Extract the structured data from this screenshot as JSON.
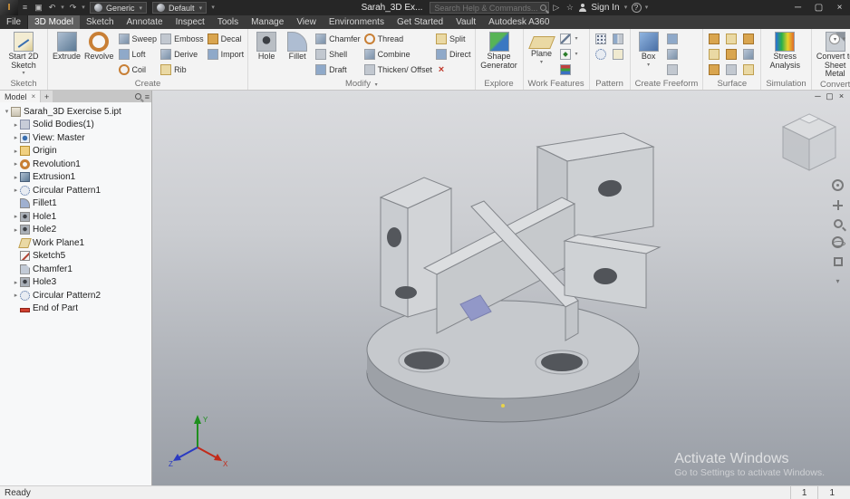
{
  "colors": {
    "titlebar_bg": "#262626",
    "tabrow_bg": "#3b3b3b",
    "ribbon_bg": "#f3f3f3",
    "viewport_gradient_top": "#dbdcdf",
    "viewport_gradient_bottom": "#989da5",
    "model_gray": "#c6c9cd",
    "selection_highlight_purple": "#9298c8"
  },
  "icons": {
    "caret_down": "▾",
    "expander_collapsed": "▸",
    "expander_expanded": "▾",
    "close": "×",
    "minimize": "─",
    "restore": "▢",
    "hamburger": "≡",
    "plus": "+",
    "save": "▣",
    "undo": "↶",
    "redo": "↷",
    "share": "▷",
    "star": "☆",
    "help": "?",
    "delete_x": "×"
  },
  "titlebar": {
    "document_title": "Sarah_3D Ex...",
    "search_placeholder": "Search Help & Commands...",
    "sign_in_label": "Sign In",
    "material_selector": "Generic",
    "appearance_selector": "Default"
  },
  "tabs": [
    "File",
    "3D Model",
    "Sketch",
    "Annotate",
    "Inspect",
    "Tools",
    "Manage",
    "View",
    "Environments",
    "Get Started",
    "Vault",
    "Autodesk A360"
  ],
  "active_tab": "3D Model",
  "ribbon": {
    "sketch": {
      "label": "Sketch",
      "start_2d_sketch": "Start 2D Sketch"
    },
    "create": {
      "label": "Create",
      "extrude": "Extrude",
      "revolve": "Revolve",
      "sweep": "Sweep",
      "loft": "Loft",
      "coil": "Coil",
      "emboss": "Emboss",
      "derive": "Derive",
      "rib": "Rib",
      "decal": "Decal",
      "import": "Import"
    },
    "modify": {
      "label": "Modify",
      "hole": "Hole",
      "fillet": "Fillet",
      "chamfer": "Chamfer",
      "shell": "Shell",
      "draft": "Draft",
      "thread": "Thread",
      "combine": "Combine",
      "thicken_offset": "Thicken/ Offset",
      "split": "Split",
      "direct": "Direct"
    },
    "explore": {
      "label": "Explore",
      "shape_generator": "Shape Generator"
    },
    "work_features": {
      "label": "Work Features",
      "plane": "Plane"
    },
    "pattern": {
      "label": "Pattern"
    },
    "freeform": {
      "label": "Create Freeform",
      "box": "Box"
    },
    "surface": {
      "label": "Surface"
    },
    "simulation": {
      "label": "Simulation",
      "stress_analysis": "Stress Analysis"
    },
    "convert": {
      "label": "Convert",
      "sheet_metal": "Convert to Sheet Metal"
    }
  },
  "browser": {
    "tab_label": "Model",
    "tree": [
      {
        "label": "Sarah_3D Exercise 5.ipt",
        "icon": "part-document",
        "expandable": true,
        "expanded": true
      },
      {
        "label": "Solid Bodies(1)",
        "icon": "solid-bodies-folder",
        "expandable": true,
        "expanded": false
      },
      {
        "label": "View: Master",
        "icon": "view-representation",
        "expandable": true,
        "expanded": false
      },
      {
        "label": "Origin",
        "icon": "origin-folder",
        "expandable": true,
        "expanded": false
      },
      {
        "label": "Revolution1",
        "icon": "revolve-feature",
        "expandable": true,
        "expanded": false
      },
      {
        "label": "Extrusion1",
        "icon": "extrude-feature",
        "expandable": true,
        "expanded": false
      },
      {
        "label": "Circular Pattern1",
        "icon": "circular-pattern-feature",
        "expandable": true,
        "expanded": false
      },
      {
        "label": "Fillet1",
        "icon": "fillet-feature",
        "expandable": false,
        "expanded": false
      },
      {
        "label": "Hole1",
        "icon": "hole-feature",
        "expandable": true,
        "expanded": false
      },
      {
        "label": "Hole2",
        "icon": "hole-feature",
        "expandable": true,
        "expanded": false
      },
      {
        "label": "Work Plane1",
        "icon": "work-plane",
        "expandable": false,
        "expanded": false
      },
      {
        "label": "Sketch5",
        "icon": "sketch",
        "expandable": false,
        "expanded": false
      },
      {
        "label": "Chamfer1",
        "icon": "chamfer-feature",
        "expandable": false,
        "expanded": false
      },
      {
        "label": "Hole3",
        "icon": "hole-feature",
        "expandable": true,
        "expanded": false
      },
      {
        "label": "Circular Pattern2",
        "icon": "circular-pattern-feature",
        "expandable": true,
        "expanded": false
      },
      {
        "label": "End of Part",
        "icon": "end-of-part",
        "expandable": false,
        "expanded": false
      }
    ]
  },
  "viewport": {
    "activate_line1": "Activate Windows",
    "activate_line2": "Go to Settings to activate Windows.",
    "axis_labels": {
      "x": "X",
      "y": "Y",
      "z": "Z"
    }
  },
  "statusbar": {
    "status": "Ready",
    "counter1": "1",
    "counter2": "1"
  }
}
